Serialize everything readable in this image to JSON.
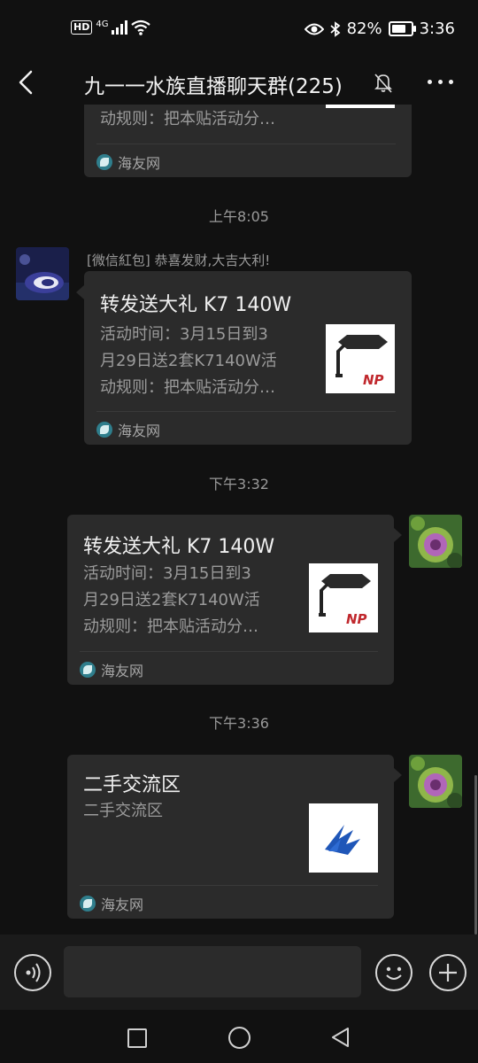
{
  "status_bar": {
    "hd": "HD",
    "network": "4G",
    "battery": "82%",
    "battery_level": 0.82,
    "time": "3:36"
  },
  "header": {
    "title": "九一一水族直播聊天群(225)",
    "back_icon": "chevron-left-icon",
    "mute_icon": "bell-off-icon",
    "more_icon": "more-icon"
  },
  "messages": {
    "card0": {
      "desc_line3": "动规则：把本贴活动分…",
      "source": "海友网"
    },
    "time1": "上午8:05",
    "msg1": {
      "sender": "[微信紅包] 恭喜发财,大吉大利!",
      "title": "转发送大礼  K7 140W",
      "desc_line1": "活动时间：3月15日到3",
      "desc_line2": "月29日送2套K7140W活",
      "desc_line3": "动规则：把本贴活动分…",
      "thumb_text": "NP",
      "source": "海友网"
    },
    "time2": "下午3:32",
    "msg2": {
      "title": "转发送大礼  K7 140W",
      "desc_line1": "活动时间：3月15日到3",
      "desc_line2": "月29日送2套K7140W活",
      "desc_line3": "动规则：把本贴活动分…",
      "thumb_text": "NP",
      "source": "海友网"
    },
    "time3": "下午3:36",
    "msg3": {
      "title": "二手交流区",
      "desc_line1": "二手交流区",
      "source": "海友网"
    }
  },
  "input_bar": {
    "voice_icon": "voice-icon",
    "emoji_icon": "emoji-icon",
    "plus_icon": "plus-icon",
    "placeholder": ""
  },
  "nav_bar": {
    "recents_icon": "square-icon",
    "home_icon": "circle-icon",
    "back_icon": "triangle-back-icon"
  },
  "colors": {
    "background": "#111111",
    "bubble": "#2b2b2b",
    "secondary_text": "#9b9b9b",
    "source_logo": "#2f7e8c"
  }
}
